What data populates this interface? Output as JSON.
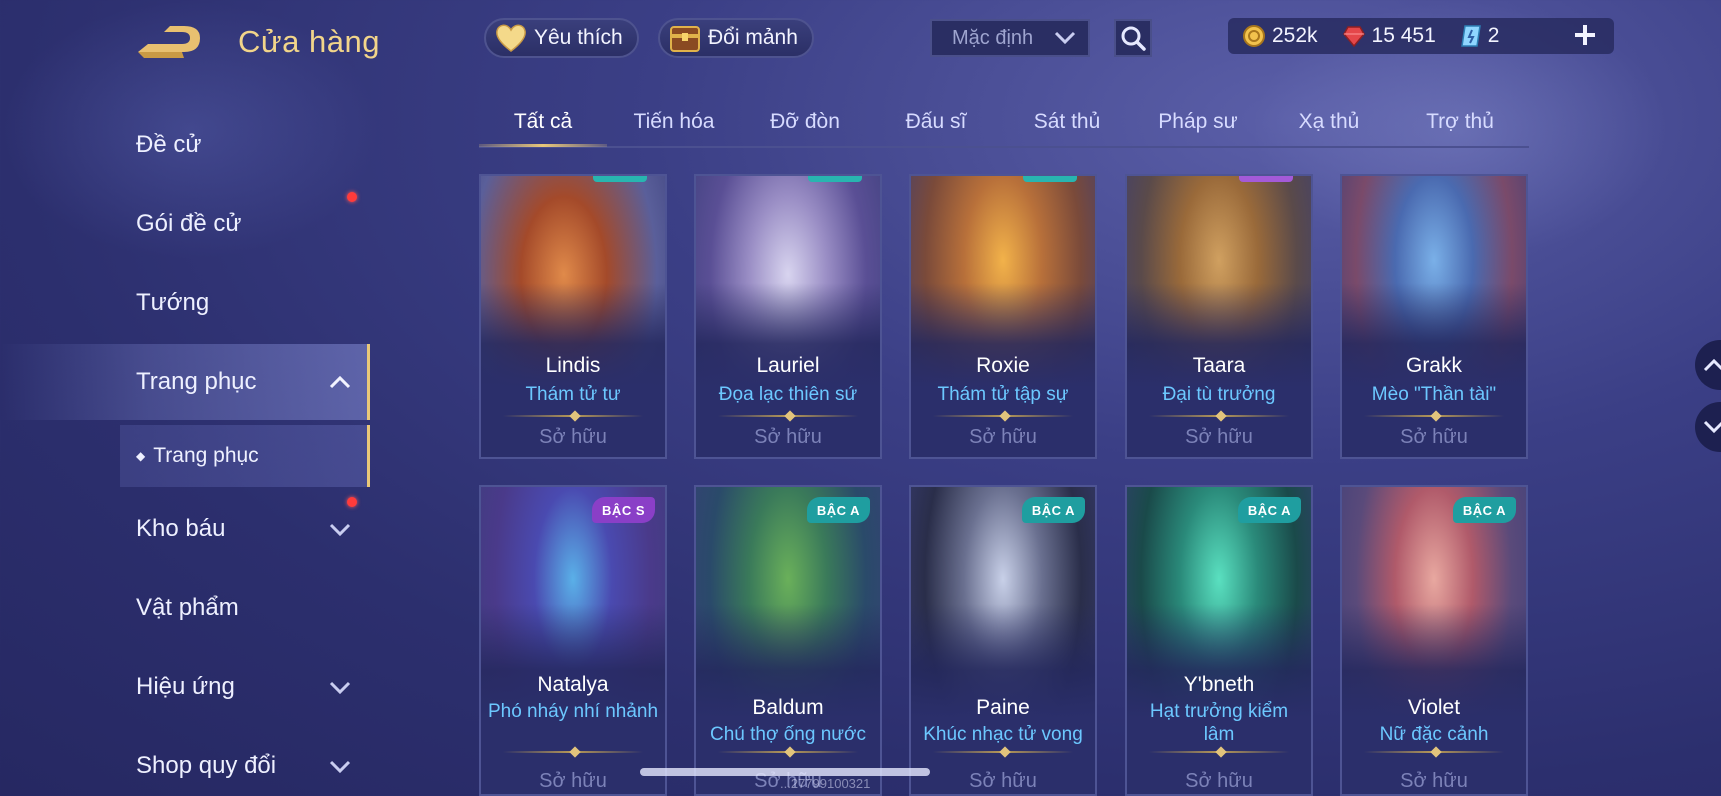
{
  "header": {
    "title": "Cửa hàng",
    "favorites_label": "Yêu thích",
    "exchange_label": "Đổi mảnh",
    "sort_value": "Mặc định"
  },
  "currency": {
    "gold": "252k",
    "vouchers": "15 451",
    "tokens": "2"
  },
  "sidebar": {
    "items": [
      {
        "label": "Đề cử"
      },
      {
        "label": "Gói đề cử"
      },
      {
        "label": "Tướng"
      },
      {
        "label": "Trang phục"
      },
      {
        "label": "Kho báu"
      },
      {
        "label": "Vật phẩm"
      },
      {
        "label": "Hiệu ứng"
      },
      {
        "label": "Shop quy đổi"
      }
    ],
    "sub_item": "Trang phục"
  },
  "tabs": [
    "Tất cả",
    "Tiến hóa",
    "Đỡ đòn",
    "Đấu sĩ",
    "Sát thủ",
    "Pháp sư",
    "Xạ thủ",
    "Trợ thủ"
  ],
  "cards": [
    {
      "hero": "Lindis",
      "skin": "Thám tử tư",
      "status": "Sở hữu",
      "badge": ""
    },
    {
      "hero": "Lauriel",
      "skin": "Đọa lạc thiên sứ",
      "status": "Sở hữu",
      "badge": ""
    },
    {
      "hero": "Roxie",
      "skin": "Thám tử tập sự",
      "status": "Sở hữu",
      "badge": ""
    },
    {
      "hero": "Taara",
      "skin": "Đại tù trưởng",
      "status": "Sở hữu",
      "badge": ""
    },
    {
      "hero": "Grakk",
      "skin": "Mèo \"Thần tài\"",
      "status": "Sở hữu",
      "badge": ""
    },
    {
      "hero": "Natalya",
      "skin": "Phó nháy nhí nhảnh",
      "status": "Sở hữu",
      "badge": "BẬC S"
    },
    {
      "hero": "Baldum",
      "skin": "Chú thợ ống nước",
      "status": "Sở hữu",
      "badge": "BẬC A"
    },
    {
      "hero": "Paine",
      "skin": "Khúc nhạc tử vong",
      "status": "Sở hữu",
      "badge": "BẬC A"
    },
    {
      "hero": "Y'bneth",
      "skin": "Hạt trưởng kiểm lâm",
      "status": "Sở hữu",
      "badge": "BẬC A"
    },
    {
      "hero": "Violet",
      "skin": "Nữ đặc cảnh",
      "status": "Sở hữu",
      "badge": "BẬC A"
    }
  ],
  "watermark": "...27799100321",
  "colors": {
    "accent_gold": "#e9c879",
    "skin_name": "#6cc8ff",
    "badge_s": "#8a3fc7",
    "badge_a": "#1f9ea0",
    "notification": "#ff3b3b"
  },
  "icons": {
    "back": "back-arrow-icon",
    "favorites": "heart-icon",
    "exchange": "chest-icon",
    "search": "search-icon",
    "gold": "gold-coin-icon",
    "voucher": "red-gem-icon",
    "token": "blue-card-icon",
    "add": "plus-icon"
  }
}
